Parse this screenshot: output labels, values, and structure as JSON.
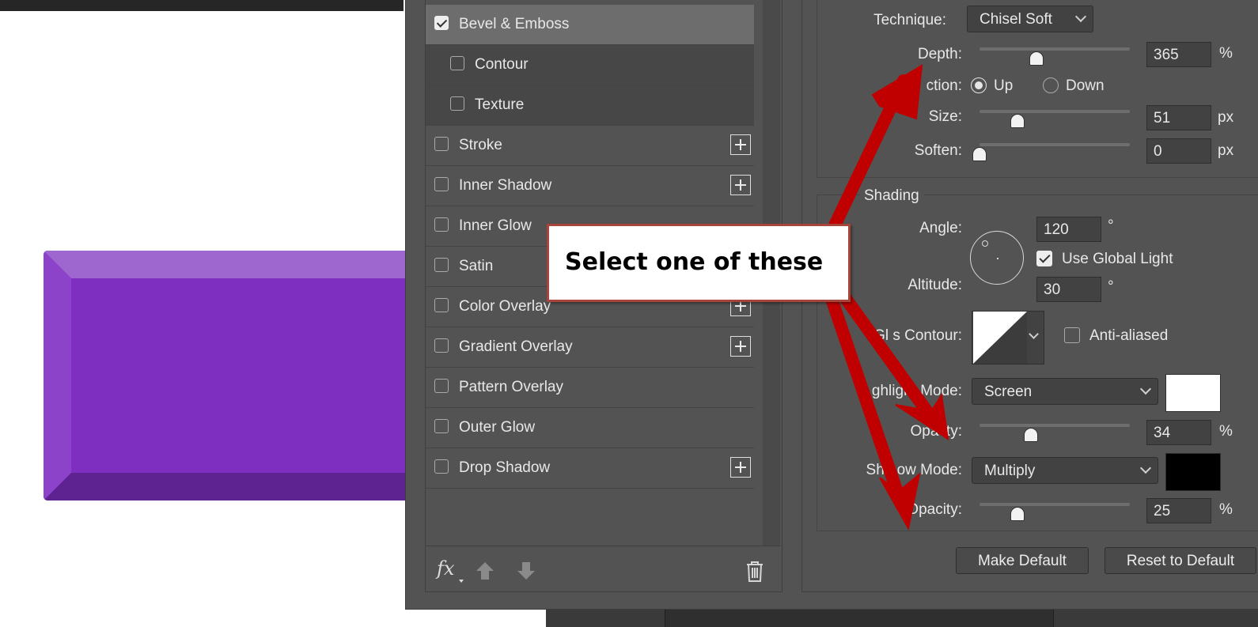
{
  "callout": {
    "text": "Select one of these"
  },
  "styles_list": [
    {
      "label": "Bevel & Emboss",
      "checked": true,
      "selected": true,
      "sub": false,
      "plus": false
    },
    {
      "label": "Contour",
      "checked": false,
      "selected": false,
      "sub": true,
      "plus": false
    },
    {
      "label": "Texture",
      "checked": false,
      "selected": false,
      "sub": true,
      "plus": false
    },
    {
      "label": "Stroke",
      "checked": false,
      "selected": false,
      "sub": false,
      "plus": true
    },
    {
      "label": "Inner Shadow",
      "checked": false,
      "selected": false,
      "sub": false,
      "plus": true
    },
    {
      "label": "Inner Glow",
      "checked": false,
      "selected": false,
      "sub": false,
      "plus": false
    },
    {
      "label": "Satin",
      "checked": false,
      "selected": false,
      "sub": false,
      "plus": false
    },
    {
      "label": "Color Overlay",
      "checked": false,
      "selected": false,
      "sub": false,
      "plus": true
    },
    {
      "label": "Gradient Overlay",
      "checked": false,
      "selected": false,
      "sub": false,
      "plus": true
    },
    {
      "label": "Pattern Overlay",
      "checked": false,
      "selected": false,
      "sub": false,
      "plus": false
    },
    {
      "label": "Outer Glow",
      "checked": false,
      "selected": false,
      "sub": false,
      "plus": false
    },
    {
      "label": "Drop Shadow",
      "checked": false,
      "selected": false,
      "sub": false,
      "plus": true
    }
  ],
  "footer": {
    "fx_label": "fx",
    "icons": [
      "fx-icon",
      "move-up-arrow-icon",
      "move-down-arrow-icon",
      "trash-icon"
    ]
  },
  "structure": {
    "technique_label": "Technique:",
    "technique_value": "Chisel Soft",
    "depth_label": "Depth:",
    "depth_value": "365",
    "depth_unit": "%",
    "depth_slider": 0.38,
    "direction_label": "ction:",
    "direction_up": "Up",
    "direction_down": "Down",
    "direction_selected": "Up",
    "size_label": "Size:",
    "size_value": "51",
    "size_unit": "px",
    "size_slider": 0.25,
    "soften_label": "Soften:",
    "soften_value": "0",
    "soften_unit": "px",
    "soften_slider": 0.0
  },
  "shading": {
    "legend": "Shading",
    "angle_label": "Angle:",
    "angle_value": "120",
    "angle_unit": "°",
    "use_global_light_label": "Use Global Light",
    "use_global_light_checked": true,
    "altitude_label": "Altitude:",
    "altitude_value": "30",
    "altitude_unit": "°",
    "gloss_contour_label": "Gl s Contour:",
    "anti_aliased_label": "Anti-aliased",
    "anti_aliased_checked": false,
    "highlight_mode_label": "H ghlight Mode:",
    "highlight_mode_value": "Screen",
    "highlight_color": "#ffffff",
    "highlight_opacity_label": "Opa ity:",
    "highlight_opacity_value": "34",
    "highlight_opacity_unit": "%",
    "highlight_opacity_slider": 0.34,
    "shadow_mode_label": "Sha ow Mode:",
    "shadow_mode_value": "Multiply",
    "shadow_color": "#000000",
    "shadow_opacity_label": "Opacity:",
    "shadow_opacity_value": "25",
    "shadow_opacity_unit": "%",
    "shadow_opacity_slider": 0.25
  },
  "buttons": {
    "make_default": "Make Default",
    "reset_to_default": "Reset to Default"
  },
  "colors": {
    "purple_face": "#7f2fbf",
    "dialog_bg": "#535353",
    "arrow_red": "#c00000",
    "callout_border": "#a8453a"
  }
}
